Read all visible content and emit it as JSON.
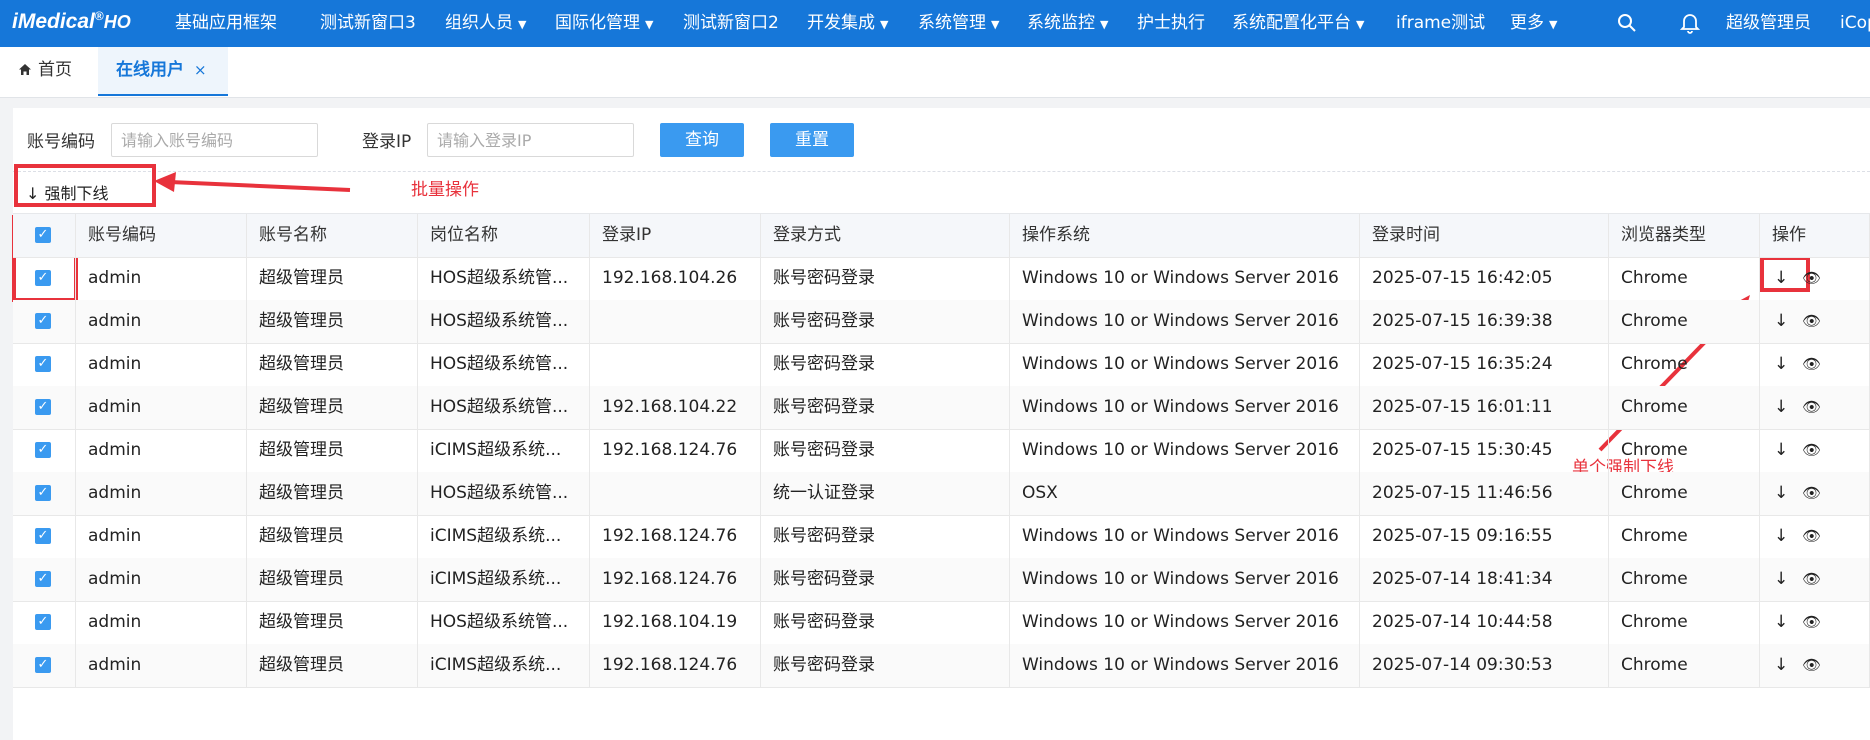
{
  "colors": {
    "accent": "#1677d9",
    "button": "#3a9af0",
    "annotation": "#e8323c"
  },
  "brand": {
    "logo": "iMedical",
    "logo_suffix": "HO",
    "registered": "®"
  },
  "nav": {
    "items": [
      {
        "label": "基础应用框架",
        "dropdown": false
      },
      {
        "label": "测试新窗口3",
        "dropdown": false
      },
      {
        "label": "组织人员",
        "dropdown": true
      },
      {
        "label": "国际化管理",
        "dropdown": true
      },
      {
        "label": "测试新窗口2",
        "dropdown": false
      },
      {
        "label": "开发集成",
        "dropdown": true
      },
      {
        "label": "系统管理",
        "dropdown": true
      },
      {
        "label": "系统监控",
        "dropdown": true
      },
      {
        "label": "护士执行",
        "dropdown": false
      },
      {
        "label": "系统配置化平台",
        "dropdown": true
      },
      {
        "label": "iframe测试",
        "dropdown": false
      },
      {
        "label": "更多",
        "dropdown": true
      }
    ],
    "search_icon": "search-icon",
    "bell_icon": "bell-icon",
    "user": "超级管理员",
    "extra": "iCop"
  },
  "tabs": {
    "home": "首页",
    "active": "在线用户",
    "close": "×"
  },
  "search": {
    "account_label": "账号编码",
    "account_placeholder": "请输入账号编码",
    "ip_label": "登录IP",
    "ip_placeholder": "请输入登录IP",
    "query_button": "查询",
    "reset_button": "重置"
  },
  "batch": {
    "force_offline": "强制下线",
    "arrow": "↓"
  },
  "annotations": {
    "batch": "批量操作",
    "single": "单个强制下线"
  },
  "table": {
    "columns": [
      "账号编码",
      "账号名称",
      "岗位名称",
      "登录IP",
      "登录方式",
      "操作系统",
      "登录时间",
      "浏览器类型",
      "操作"
    ],
    "rows": [
      {
        "code": "admin",
        "name": "超级管理员",
        "post": "HOS超级系统管...",
        "ip": "192.168.104.26",
        "method": "账号密码登录",
        "os": "Windows 10 or Windows Server 2016",
        "time": "2025-07-15 16:42:05",
        "browser": "Chrome"
      },
      {
        "code": "admin",
        "name": "超级管理员",
        "post": "HOS超级系统管...",
        "ip": "",
        "method": "账号密码登录",
        "os": "Windows 10 or Windows Server 2016",
        "time": "2025-07-15 16:39:38",
        "browser": "Chrome"
      },
      {
        "code": "admin",
        "name": "超级管理员",
        "post": "HOS超级系统管...",
        "ip": "",
        "method": "账号密码登录",
        "os": "Windows 10 or Windows Server 2016",
        "time": "2025-07-15 16:35:24",
        "browser": "Chrome"
      },
      {
        "code": "admin",
        "name": "超级管理员",
        "post": "HOS超级系统管...",
        "ip": "192.168.104.22",
        "method": "账号密码登录",
        "os": "Windows 10 or Windows Server 2016",
        "time": "2025-07-15 16:01:11",
        "browser": "Chrome"
      },
      {
        "code": "admin",
        "name": "超级管理员",
        "post": "iCIMS超级系统...",
        "ip": "192.168.124.76",
        "method": "账号密码登录",
        "os": "Windows 10 or Windows Server 2016",
        "time": "2025-07-15 15:30:45",
        "browser": "Chrome"
      },
      {
        "code": "admin",
        "name": "超级管理员",
        "post": "HOS超级系统管...",
        "ip": "",
        "method": "统一认证登录",
        "os": "OSX",
        "time": "2025-07-15 11:46:56",
        "browser": "Chrome"
      },
      {
        "code": "admin",
        "name": "超级管理员",
        "post": "iCIMS超级系统...",
        "ip": "192.168.124.76",
        "method": "账号密码登录",
        "os": "Windows 10 or Windows Server 2016",
        "time": "2025-07-15 09:16:55",
        "browser": "Chrome"
      },
      {
        "code": "admin",
        "name": "超级管理员",
        "post": "iCIMS超级系统...",
        "ip": "192.168.124.76",
        "method": "账号密码登录",
        "os": "Windows 10 or Windows Server 2016",
        "time": "2025-07-14 18:41:34",
        "browser": "Chrome"
      },
      {
        "code": "admin",
        "name": "超级管理员",
        "post": "HOS超级系统管...",
        "ip": "192.168.104.19",
        "method": "账号密码登录",
        "os": "Windows 10 or Windows Server 2016",
        "time": "2025-07-14 10:44:58",
        "browser": "Chrome"
      },
      {
        "code": "admin",
        "name": "超级管理员",
        "post": "iCIMS超级系统...",
        "ip": "192.168.124.76",
        "method": "账号密码登录",
        "os": "Windows 10 or Windows Server 2016",
        "time": "2025-07-14 09:30:53",
        "browser": "Chrome"
      }
    ],
    "row_checked": true,
    "header_checked": true,
    "action_icons": {
      "offline": "↓",
      "view": "👁"
    }
  }
}
